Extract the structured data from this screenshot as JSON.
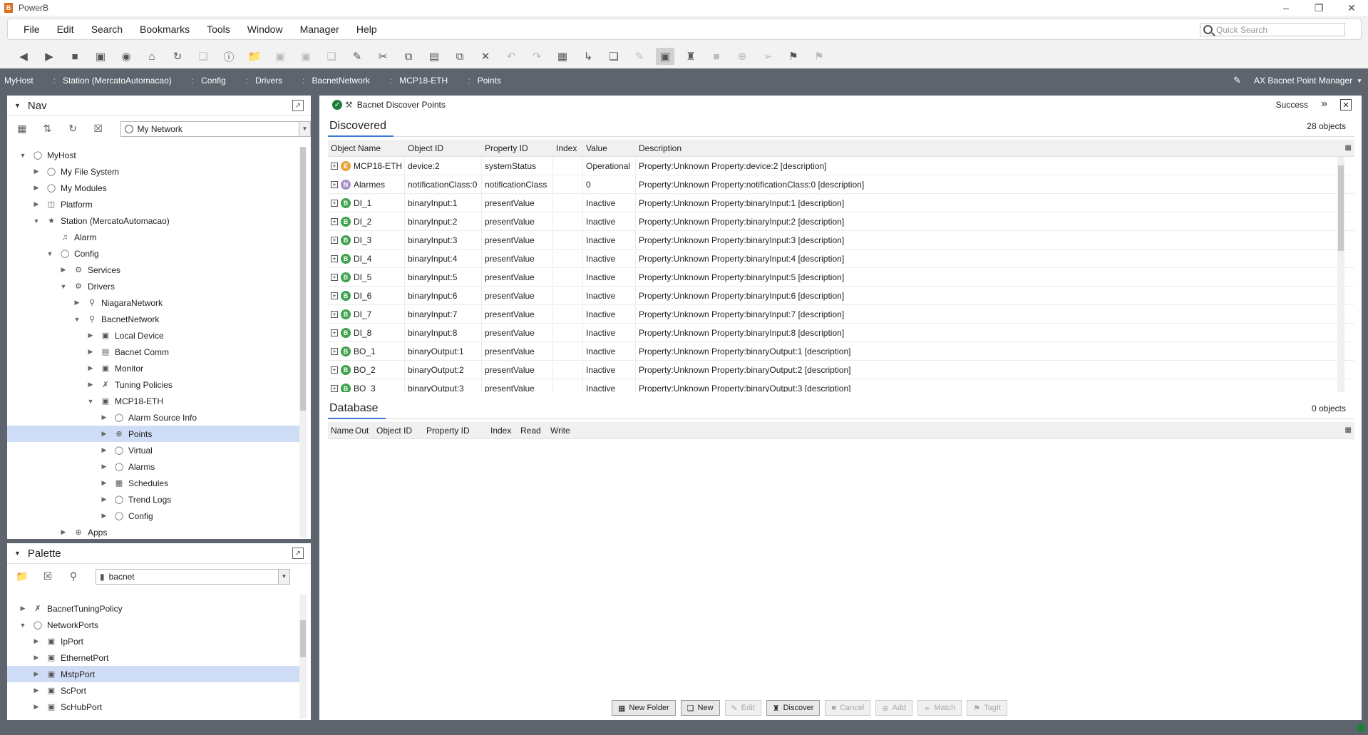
{
  "window": {
    "title": "PowerB",
    "app_icon_letter": "B"
  },
  "menu": [
    "File",
    "Edit",
    "Search",
    "Bookmarks",
    "Tools",
    "Window",
    "Manager",
    "Help"
  ],
  "quick_search": {
    "placeholder": "Quick Search"
  },
  "breadcrumbs": [
    "MyHost",
    "Station (MercatoAutomacao)",
    "Config",
    "Drivers",
    "BacnetNetwork",
    "MCP18-ETH",
    "Points"
  ],
  "view_selector": {
    "label": "AX Bacnet Point Manager"
  },
  "nav": {
    "title": "Nav",
    "combo_value": "My Network",
    "tree": [
      {
        "label": "MyHost",
        "depth": 0,
        "expanded": true,
        "icon": "host-icon"
      },
      {
        "label": "My File System",
        "depth": 1,
        "expanded": false,
        "icon": "host-icon"
      },
      {
        "label": "My Modules",
        "depth": 1,
        "expanded": false,
        "icon": "modules-icon"
      },
      {
        "label": "Platform",
        "depth": 1,
        "expanded": false,
        "icon": "platform-icon"
      },
      {
        "label": "Station (MercatoAutomacao)",
        "depth": 1,
        "expanded": true,
        "icon": "station-icon"
      },
      {
        "label": "Alarm",
        "depth": 2,
        "expanded": null,
        "icon": "bell-icon"
      },
      {
        "label": "Config",
        "depth": 2,
        "expanded": true,
        "icon": "config-icon"
      },
      {
        "label": "Services",
        "depth": 3,
        "expanded": false,
        "icon": "gear-icon"
      },
      {
        "label": "Drivers",
        "depth": 3,
        "expanded": true,
        "icon": "driver-icon"
      },
      {
        "label": "NiagaraNetwork",
        "depth": 4,
        "expanded": false,
        "icon": "network-icon"
      },
      {
        "label": "BacnetNetwork",
        "depth": 4,
        "expanded": true,
        "icon": "network-icon"
      },
      {
        "label": "Local Device",
        "depth": 5,
        "expanded": false,
        "icon": "device-icon"
      },
      {
        "label": "Bacnet Comm",
        "depth": 5,
        "expanded": false,
        "icon": "comm-icon"
      },
      {
        "label": "Monitor",
        "depth": 5,
        "expanded": false,
        "icon": "monitor-icon"
      },
      {
        "label": "Tuning Policies",
        "depth": 5,
        "expanded": false,
        "icon": "tuning-icon"
      },
      {
        "label": "MCP18-ETH",
        "depth": 5,
        "expanded": true,
        "icon": "device-icon"
      },
      {
        "label": "Alarm Source Info",
        "depth": 6,
        "expanded": false,
        "icon": "alarm-source-icon"
      },
      {
        "label": "Points",
        "depth": 6,
        "expanded": false,
        "icon": "points-icon",
        "selected": true
      },
      {
        "label": "Virtual",
        "depth": 6,
        "expanded": false,
        "icon": "virtual-icon"
      },
      {
        "label": "Alarms",
        "depth": 6,
        "expanded": false,
        "icon": "alarms-icon"
      },
      {
        "label": "Schedules",
        "depth": 6,
        "expanded": false,
        "icon": "schedules-icon"
      },
      {
        "label": "Trend Logs",
        "depth": 6,
        "expanded": false,
        "icon": "trend-icon"
      },
      {
        "label": "Config",
        "depth": 6,
        "expanded": false,
        "icon": "config-icon"
      },
      {
        "label": "Apps",
        "depth": 3,
        "expanded": false,
        "icon": "apps-icon"
      }
    ]
  },
  "palette": {
    "title": "Palette",
    "combo_value": "bacnet",
    "tree": [
      {
        "label": "BacnetTuningPolicy",
        "depth": 0,
        "expanded": false,
        "icon": "tuning-icon"
      },
      {
        "label": "NetworkPorts",
        "depth": 0,
        "expanded": true,
        "icon": "host-icon"
      },
      {
        "label": "IpPort",
        "depth": 1,
        "expanded": false,
        "icon": "port-icon"
      },
      {
        "label": "EthernetPort",
        "depth": 1,
        "expanded": false,
        "icon": "port-icon"
      },
      {
        "label": "MstpPort",
        "depth": 1,
        "expanded": false,
        "icon": "port-icon",
        "selected": true
      },
      {
        "label": "ScPort",
        "depth": 1,
        "expanded": false,
        "icon": "port-icon"
      },
      {
        "label": "ScHubPort",
        "depth": 1,
        "expanded": false,
        "icon": "port-icon"
      }
    ]
  },
  "job": {
    "title": "Bacnet Discover Points",
    "status": "Success"
  },
  "discovered": {
    "tab_label": "Discovered",
    "count": "28 objects",
    "columns": [
      "Object Name",
      "Object ID",
      "Property ID",
      "Index",
      "Value",
      "Description"
    ],
    "rows": [
      {
        "badge": "E",
        "color": "#e8a33c",
        "name": "MCP18-ETH",
        "oid": "device:2",
        "pid": "systemStatus",
        "index": "",
        "value": "Operational",
        "desc": "Property:Unknown Property:device:2 [description]"
      },
      {
        "badge": "N",
        "color": "#a590c8",
        "name": "Alarmes",
        "oid": "notificationClass:0",
        "pid": "notificationClass",
        "index": "",
        "value": "0",
        "desc": "Property:Unknown Property:notificationClass:0 [description]"
      },
      {
        "badge": "B",
        "color": "#3fa34d",
        "name": "DI_1",
        "oid": "binaryInput:1",
        "pid": "presentValue",
        "index": "",
        "value": "Inactive",
        "desc": "Property:Unknown Property:binaryInput:1 [description]"
      },
      {
        "badge": "B",
        "color": "#3fa34d",
        "name": "DI_2",
        "oid": "binaryInput:2",
        "pid": "presentValue",
        "index": "",
        "value": "Inactive",
        "desc": "Property:Unknown Property:binaryInput:2 [description]"
      },
      {
        "badge": "B",
        "color": "#3fa34d",
        "name": "DI_3",
        "oid": "binaryInput:3",
        "pid": "presentValue",
        "index": "",
        "value": "Inactive",
        "desc": "Property:Unknown Property:binaryInput:3 [description]"
      },
      {
        "badge": "B",
        "color": "#3fa34d",
        "name": "DI_4",
        "oid": "binaryInput:4",
        "pid": "presentValue",
        "index": "",
        "value": "Inactive",
        "desc": "Property:Unknown Property:binaryInput:4 [description]"
      },
      {
        "badge": "B",
        "color": "#3fa34d",
        "name": "DI_5",
        "oid": "binaryInput:5",
        "pid": "presentValue",
        "index": "",
        "value": "Inactive",
        "desc": "Property:Unknown Property:binaryInput:5 [description]"
      },
      {
        "badge": "B",
        "color": "#3fa34d",
        "name": "DI_6",
        "oid": "binaryInput:6",
        "pid": "presentValue",
        "index": "",
        "value": "Inactive",
        "desc": "Property:Unknown Property:binaryInput:6 [description]"
      },
      {
        "badge": "B",
        "color": "#3fa34d",
        "name": "DI_7",
        "oid": "binaryInput:7",
        "pid": "presentValue",
        "index": "",
        "value": "Inactive",
        "desc": "Property:Unknown Property:binaryInput:7 [description]"
      },
      {
        "badge": "B",
        "color": "#3fa34d",
        "name": "DI_8",
        "oid": "binaryInput:8",
        "pid": "presentValue",
        "index": "",
        "value": "Inactive",
        "desc": "Property:Unknown Property:binaryInput:8 [description]"
      },
      {
        "badge": "B",
        "color": "#3fa34d",
        "name": "BO_1",
        "oid": "binaryOutput:1",
        "pid": "presentValue",
        "index": "",
        "value": "Inactive",
        "desc": "Property:Unknown Property:binaryOutput:1 [description]"
      },
      {
        "badge": "B",
        "color": "#3fa34d",
        "name": "BO_2",
        "oid": "binaryOutput:2",
        "pid": "presentValue",
        "index": "",
        "value": "Inactive",
        "desc": "Property:Unknown Property:binaryOutput:2 [description]"
      },
      {
        "badge": "B",
        "color": "#3fa34d",
        "name": "BO_3",
        "oid": "binaryOutput:3",
        "pid": "presentValue",
        "index": "",
        "value": "Inactive",
        "desc": "Property:Unknown Property:binaryOutput:3 [description]"
      }
    ]
  },
  "database": {
    "tab_label": "Database",
    "count": "0 objects",
    "columns": [
      "Name",
      "Out",
      "Object ID",
      "Property ID",
      "Index",
      "Read",
      "Write"
    ]
  },
  "buttons": [
    {
      "label": "New Folder",
      "enabled": true,
      "icon": "folder-icon"
    },
    {
      "label": "New",
      "enabled": true,
      "icon": "new-icon"
    },
    {
      "label": "Edit",
      "enabled": false,
      "icon": "edit-icon"
    },
    {
      "label": "Discover",
      "enabled": true,
      "icon": "discover-icon"
    },
    {
      "label": "Cancel",
      "enabled": false,
      "icon": "cancel-icon"
    },
    {
      "label": "Add",
      "enabled": false,
      "icon": "add-icon"
    },
    {
      "label": "Match",
      "enabled": false,
      "icon": "match-icon"
    },
    {
      "label": "TagIt",
      "enabled": false,
      "icon": "tag-icon"
    }
  ]
}
